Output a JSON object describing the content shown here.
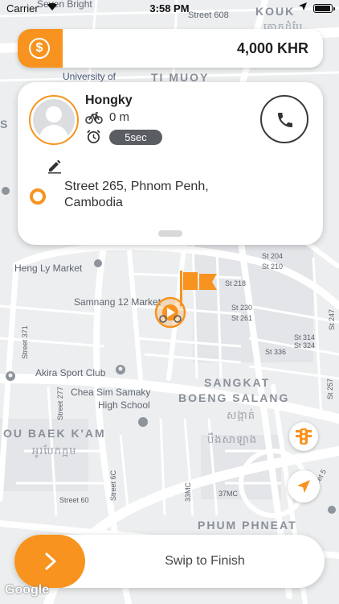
{
  "status_bar": {
    "carrier": "Carrier",
    "time": "3:58 PM"
  },
  "fare": {
    "amount": "4,000 KHR",
    "currency_icon": "dollar-coin-icon"
  },
  "driver": {
    "name": "Hongky",
    "distance": "0 m",
    "wait_time": "5sec"
  },
  "pickup": {
    "address": "Street 265, Phnom Penh, Cambodia"
  },
  "swipe": {
    "label": "Swip to Finish"
  },
  "map_labels": {
    "seven_bright": "Seven Bright",
    "street_608": "Street 608",
    "kouk": "KOUK",
    "university": "University of",
    "tuol_svay": "TI  MUOY",
    "khmer_1": "គោកដំបែ",
    "heng_ly": "Heng Ly Market",
    "samnang": "Samnang 12 Market",
    "akira": "Akira Sport Club",
    "chea_sim": "Chea Sim Samaky",
    "high_school": "High School",
    "sangkat": "SANGKAT",
    "boeng_salang": "BOENG SALANG",
    "khmer_2": "សង្កាត់",
    "khmer_3": "បឹងសាឡាង",
    "ou_baek_kam": "OU BAEK K'AM",
    "khmer_4": "អូរបែកក្អម",
    "phum_phneat": "PHUM PHNEAT",
    "st_204": "St 204",
    "st_210": "St 210",
    "st_218": "St 218",
    "st_230": "St 230",
    "st_261": "St 261",
    "st_314": "St 314",
    "st_324": "St 324",
    "st_336": "St 336",
    "st_247": "St 247",
    "st_257": "St 257",
    "st_371": "Street 371",
    "st_277": "Street 277",
    "st_60": "Street 60",
    "st_6c": "Street 6C",
    "st_33mc": "33MC",
    "st_37mc": "37MC",
    "st_5": "Street 5",
    "s": "S"
  },
  "google": "Google"
}
